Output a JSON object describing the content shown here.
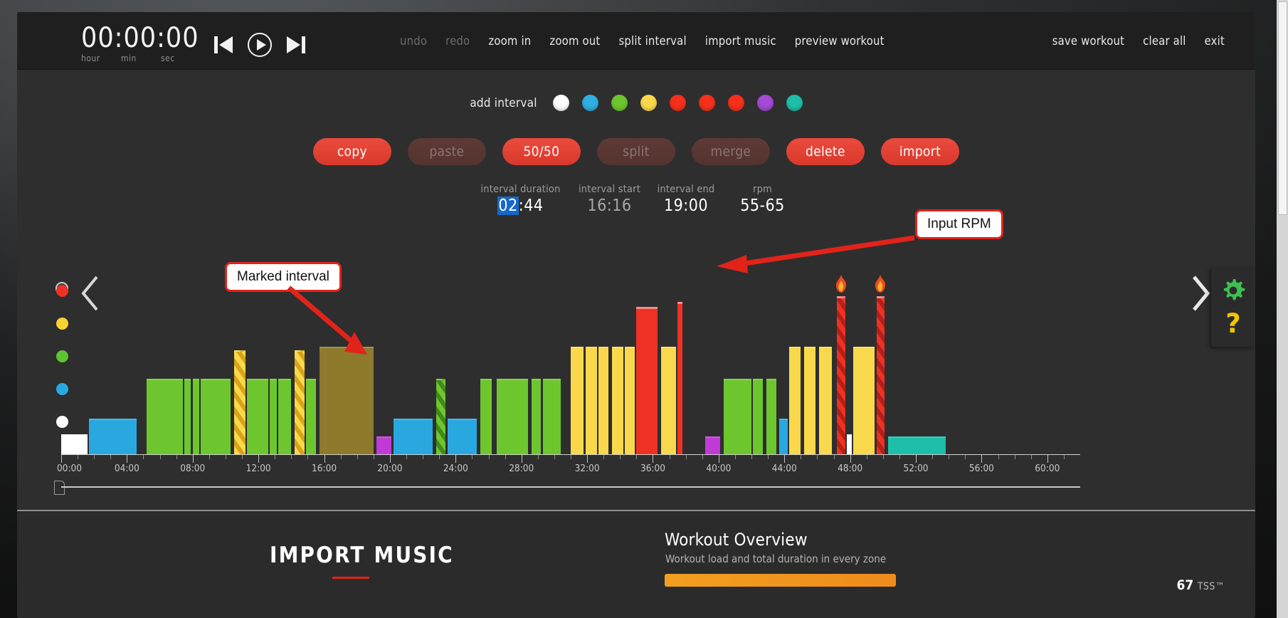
{
  "topbar": {
    "clock": {
      "value": "00:00:00",
      "hour_label": "hour",
      "min_label": "min",
      "sec_label": "sec"
    },
    "transport": {
      "prev": "skip-back",
      "play": "play",
      "next": "skip-forward"
    },
    "menu_center": [
      {
        "label": "undo",
        "disabled": true
      },
      {
        "label": "redo",
        "disabled": true
      },
      {
        "label": "zoom in",
        "disabled": false
      },
      {
        "label": "zoom out",
        "disabled": false
      },
      {
        "label": "split interval",
        "disabled": false
      },
      {
        "label": "import music",
        "disabled": false
      },
      {
        "label": "preview workout",
        "disabled": false
      }
    ],
    "menu_right": [
      {
        "label": "save workout"
      },
      {
        "label": "clear all"
      },
      {
        "label": "exit"
      }
    ]
  },
  "editor": {
    "add_interval_label": "add interval",
    "swatches": [
      {
        "name": "white",
        "color": "#ffffff"
      },
      {
        "name": "blue",
        "color": "#2fafe2"
      },
      {
        "name": "green",
        "color": "#6ec62f"
      },
      {
        "name": "yellow",
        "color": "#f9d94b"
      },
      {
        "name": "red-1",
        "color": "#f7301c"
      },
      {
        "name": "red-2",
        "color": "#f7301c"
      },
      {
        "name": "red-3",
        "color": "#f7301c"
      },
      {
        "name": "purple",
        "color": "#a34ad6"
      },
      {
        "name": "teal",
        "color": "#1ebfa8"
      }
    ],
    "buttons": [
      {
        "label": "copy",
        "disabled": false
      },
      {
        "label": "paste",
        "disabled": true
      },
      {
        "label": "50/50",
        "disabled": false
      },
      {
        "label": "split",
        "disabled": true
      },
      {
        "label": "merge",
        "disabled": true
      },
      {
        "label": "delete",
        "disabled": false
      },
      {
        "label": "import",
        "disabled": false
      }
    ],
    "interval_info": {
      "duration_label": "interval duration",
      "duration_selected": "02",
      "duration_rest": ":44",
      "start_label": "interval start",
      "start_value": "16:16",
      "end_label": "interval end",
      "end_value": "19:00",
      "rpm_label": "rpm",
      "rpm_value": "55-65"
    },
    "nav": {
      "prev": "previous-page",
      "next": "next-page"
    },
    "zone_dots": [
      {
        "name": "zone-red",
        "color": "#ee3124"
      },
      {
        "name": "zone-yellow",
        "color": "#f7d331"
      },
      {
        "name": "zone-green",
        "color": "#5cc433"
      },
      {
        "name": "zone-blue",
        "color": "#29a8e0"
      },
      {
        "name": "zone-white",
        "color": "#ffffff"
      }
    ],
    "callouts": [
      {
        "name": "marked-interval",
        "text": "Marked interval"
      },
      {
        "name": "input-rpm",
        "text": "Input RPM"
      }
    ],
    "side_panel": {
      "gear": "settings-gear",
      "help": "?"
    }
  },
  "chart_data": {
    "type": "bar",
    "title": "",
    "xlabel": "",
    "ylabel": "",
    "xlim": [
      0,
      62
    ],
    "ylim": [
      0,
      100
    ],
    "grid": false,
    "legend_position": "none",
    "x_tick_labels": [
      "00:00",
      "04:00",
      "08:00",
      "12:00",
      "16:00",
      "20:00",
      "24:00",
      "28:00",
      "32:00",
      "36:00",
      "40:00",
      "44:00",
      "48:00",
      "52:00",
      "56:00",
      "60:00"
    ],
    "x_tick_values": [
      0,
      4,
      8,
      12,
      16,
      20,
      24,
      28,
      32,
      36,
      40,
      44,
      48,
      52,
      56,
      60
    ],
    "zone_colors": {
      "white": "#ffffff",
      "blue": "#29a8e0",
      "green": "#6ec62f",
      "yellow": "#f9d94b",
      "red": "#ee3124",
      "purple": "#c03ad6",
      "teal": "#1ebfa8",
      "marked": "#8d7a2c"
    },
    "bars": [
      {
        "start": 0.0,
        "end": 1.6,
        "value": 11,
        "zone": "white",
        "pattern": "solid"
      },
      {
        "start": 1.7,
        "end": 4.6,
        "value": 20,
        "zone": "blue",
        "pattern": "solid"
      },
      {
        "start": 5.2,
        "end": 7.4,
        "value": 42,
        "zone": "green",
        "pattern": "solid"
      },
      {
        "start": 7.5,
        "end": 7.9,
        "value": 42,
        "zone": "green",
        "pattern": "solid"
      },
      {
        "start": 8.0,
        "end": 8.4,
        "value": 42,
        "zone": "green",
        "pattern": "solid"
      },
      {
        "start": 8.5,
        "end": 10.3,
        "value": 42,
        "zone": "green",
        "pattern": "solid"
      },
      {
        "start": 10.5,
        "end": 11.2,
        "value": 58,
        "zone": "yellow",
        "pattern": "stripe"
      },
      {
        "start": 11.3,
        "end": 12.6,
        "value": 42,
        "zone": "green",
        "pattern": "solid"
      },
      {
        "start": 12.7,
        "end": 13.1,
        "value": 42,
        "zone": "green",
        "pattern": "solid"
      },
      {
        "start": 13.2,
        "end": 14.0,
        "value": 42,
        "zone": "green",
        "pattern": "solid"
      },
      {
        "start": 14.2,
        "end": 14.8,
        "value": 58,
        "zone": "yellow",
        "pattern": "stripe"
      },
      {
        "start": 14.9,
        "end": 15.5,
        "value": 42,
        "zone": "green",
        "pattern": "solid"
      },
      {
        "start": 15.7,
        "end": 19.0,
        "value": 60,
        "zone": "marked",
        "pattern": "solid"
      },
      {
        "start": 19.2,
        "end": 20.1,
        "value": 10,
        "zone": "purple",
        "pattern": "solid"
      },
      {
        "start": 20.2,
        "end": 22.6,
        "value": 20,
        "zone": "blue",
        "pattern": "solid"
      },
      {
        "start": 22.8,
        "end": 23.4,
        "value": 42,
        "zone": "green",
        "pattern": "stripe"
      },
      {
        "start": 23.5,
        "end": 25.3,
        "value": 20,
        "zone": "blue",
        "pattern": "solid"
      },
      {
        "start": 25.5,
        "end": 26.2,
        "value": 42,
        "zone": "green",
        "pattern": "solid"
      },
      {
        "start": 26.5,
        "end": 28.4,
        "value": 42,
        "zone": "green",
        "pattern": "solid"
      },
      {
        "start": 28.6,
        "end": 29.2,
        "value": 42,
        "zone": "green",
        "pattern": "solid"
      },
      {
        "start": 29.3,
        "end": 30.4,
        "value": 42,
        "zone": "green",
        "pattern": "solid"
      },
      {
        "start": 31.0,
        "end": 31.8,
        "value": 60,
        "zone": "yellow",
        "pattern": "solid"
      },
      {
        "start": 31.9,
        "end": 32.6,
        "value": 60,
        "zone": "yellow",
        "pattern": "solid"
      },
      {
        "start": 32.7,
        "end": 33.3,
        "value": 60,
        "zone": "yellow",
        "pattern": "solid"
      },
      {
        "start": 33.5,
        "end": 34.2,
        "value": 60,
        "zone": "yellow",
        "pattern": "solid"
      },
      {
        "start": 34.3,
        "end": 34.9,
        "value": 60,
        "zone": "yellow",
        "pattern": "solid"
      },
      {
        "start": 35.0,
        "end": 36.3,
        "value": 82,
        "zone": "red",
        "pattern": "solid"
      },
      {
        "start": 36.5,
        "end": 37.4,
        "value": 60,
        "zone": "yellow",
        "pattern": "solid"
      },
      {
        "start": 37.5,
        "end": 37.8,
        "value": 85,
        "zone": "red",
        "pattern": "solid"
      },
      {
        "start": 39.2,
        "end": 40.1,
        "value": 10,
        "zone": "purple",
        "pattern": "solid"
      },
      {
        "start": 40.3,
        "end": 42.0,
        "value": 42,
        "zone": "green",
        "pattern": "solid"
      },
      {
        "start": 42.1,
        "end": 42.7,
        "value": 42,
        "zone": "green",
        "pattern": "solid"
      },
      {
        "start": 42.9,
        "end": 43.5,
        "value": 42,
        "zone": "green",
        "pattern": "solid"
      },
      {
        "start": 43.7,
        "end": 44.2,
        "value": 20,
        "zone": "blue",
        "pattern": "solid"
      },
      {
        "start": 44.3,
        "end": 45.0,
        "value": 60,
        "zone": "yellow",
        "pattern": "solid"
      },
      {
        "start": 45.2,
        "end": 45.9,
        "value": 60,
        "zone": "yellow",
        "pattern": "solid"
      },
      {
        "start": 46.1,
        "end": 46.9,
        "value": 60,
        "zone": "yellow",
        "pattern": "solid"
      },
      {
        "start": 47.2,
        "end": 47.7,
        "value": 88,
        "zone": "red",
        "pattern": "stripe",
        "flame": true
      },
      {
        "start": 47.8,
        "end": 48.1,
        "value": 11,
        "zone": "white",
        "pattern": "solid"
      },
      {
        "start": 48.2,
        "end": 49.5,
        "value": 60,
        "zone": "yellow",
        "pattern": "solid"
      },
      {
        "start": 49.6,
        "end": 50.1,
        "value": 88,
        "zone": "red",
        "pattern": "stripe",
        "flame": true
      },
      {
        "start": 50.3,
        "end": 53.8,
        "value": 10,
        "zone": "teal",
        "pattern": "solid"
      }
    ]
  },
  "bottom": {
    "import_music_title": "IMPORT MUSIC",
    "workout_overview_title": "Workout Overview",
    "workout_overview_sub": "Workout load and total duration in every zone",
    "tss_value": "67",
    "tss_unit": "TSS™"
  }
}
